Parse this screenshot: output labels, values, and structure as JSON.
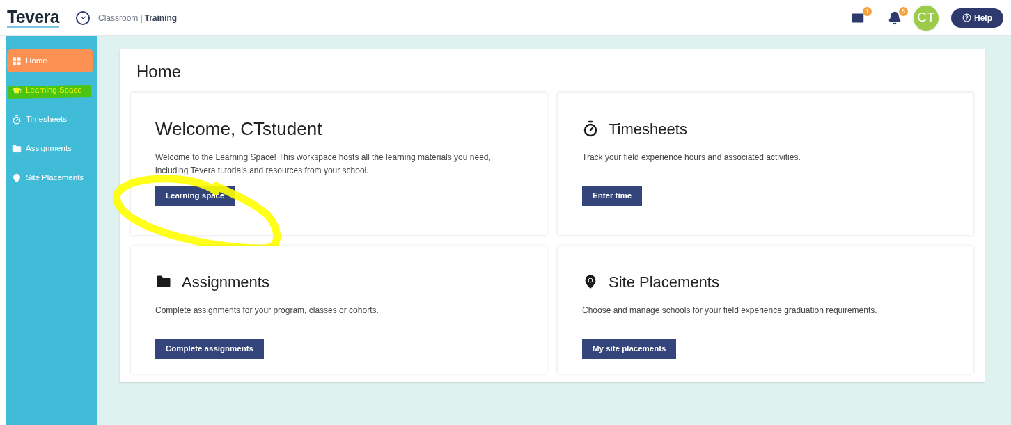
{
  "header": {
    "logo": "Tevera",
    "breadcrumb": {
      "context": "Classroom",
      "separator": "|",
      "current": "Training"
    },
    "mail_count": "1",
    "notification_count": "8",
    "avatar": "CT",
    "help": "Help"
  },
  "sidebar": {
    "items": [
      {
        "label": "Home",
        "selected": true,
        "highlighted": false
      },
      {
        "label": "Learning Space",
        "selected": false,
        "highlighted": true
      },
      {
        "label": "Timesheets",
        "selected": false,
        "highlighted": false
      },
      {
        "label": "Assignments",
        "selected": false,
        "highlighted": false
      },
      {
        "label": "Site Placements",
        "selected": false,
        "highlighted": false
      }
    ]
  },
  "page": {
    "title": "Home",
    "cards": [
      {
        "title": "Welcome, CTstudent",
        "text": "Welcome to the Learning Space! This workspace hosts all the learning materials you need, including Tevera tutorials and resources from your school.",
        "button": "Learning space",
        "circled": true
      },
      {
        "title": "Timesheets",
        "text": "Track your field experience hours and associated activities.",
        "button": "Enter time",
        "circled": false
      },
      {
        "title": "Assignments",
        "text": "Complete assignments for your program, classes or cohorts.",
        "button": "Complete assignments",
        "circled": false
      },
      {
        "title": "Site Placements",
        "text": "Choose and manage schools for your field experience graduation requirements.",
        "button": "My site placements",
        "circled": false
      }
    ]
  }
}
